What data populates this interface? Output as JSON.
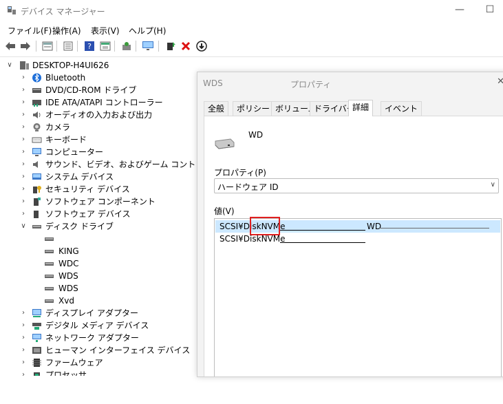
{
  "window": {
    "title": "デバイス マネージャー",
    "minimize_glyph": "—",
    "maximize_glyph": "☐"
  },
  "menu": [
    "ファイル(F)",
    "操作(A)",
    "表示(V)",
    "ヘルプ(H)"
  ],
  "toolbar_icons": [
    "back-icon",
    "forward-icon",
    "properties-view-icon",
    "help-icon",
    "show-hide-icon",
    "scan-hardware-icon",
    "monitor-icon",
    "update-driver-icon",
    "uninstall-icon",
    "download-icon"
  ],
  "tree": {
    "root": "DESKTOP-H4UI626",
    "categories": [
      {
        "label": "Bluetooth",
        "icon": "bluetooth-icon",
        "expanded": false
      },
      {
        "label": "DVD/CD-ROM ドライブ",
        "icon": "dvd-drive-icon",
        "expanded": false
      },
      {
        "label": "IDE ATA/ATAPI コントローラー",
        "icon": "ide-controller-icon",
        "expanded": false
      },
      {
        "label": "オーディオの入力および出力",
        "icon": "audio-icon",
        "expanded": false
      },
      {
        "label": "カメラ",
        "icon": "camera-icon",
        "expanded": false
      },
      {
        "label": "キーボード",
        "icon": "keyboard-icon",
        "expanded": false
      },
      {
        "label": "コンピューター",
        "icon": "computer-icon",
        "expanded": false
      },
      {
        "label": "サウンド、ビデオ、およびゲーム コントローラー",
        "icon": "sound-icon",
        "expanded": false
      },
      {
        "label": "システム デバイス",
        "icon": "system-device-icon",
        "expanded": false
      },
      {
        "label": "セキュリティ デバイス",
        "icon": "security-device-icon",
        "expanded": false
      },
      {
        "label": "ソフトウェア コンポーネント",
        "icon": "software-component-icon",
        "expanded": false
      },
      {
        "label": "ソフトウェア デバイス",
        "icon": "software-device-icon",
        "expanded": false
      },
      {
        "label": "ディスク ドライブ",
        "icon": "disk-drive-icon",
        "expanded": true
      },
      {
        "label": "ディスプレイ アダプター",
        "icon": "display-adapter-icon",
        "expanded": false
      },
      {
        "label": "デジタル メディア デバイス",
        "icon": "digital-media-icon",
        "expanded": false
      },
      {
        "label": "ネットワーク アダプター",
        "icon": "network-adapter-icon",
        "expanded": false
      },
      {
        "label": "ヒューマン インターフェイス デバイス",
        "icon": "hid-icon",
        "expanded": false
      },
      {
        "label": "ファームウェア",
        "icon": "firmware-icon",
        "expanded": false
      },
      {
        "label": "プロセッサ",
        "icon": "processor-icon",
        "expanded": false
      }
    ],
    "disk_children": [
      "",
      "KING",
      "WDC",
      "WDS",
      "WDS",
      "Xvd"
    ]
  },
  "dialog": {
    "title_device": "WDS",
    "title": "プロパティ",
    "close_glyph": "✕",
    "tabs": [
      "全般",
      "ポリシー",
      "ボリューム",
      "ドライバー",
      "詳細",
      "イベント"
    ],
    "active_tab": "詳細",
    "device_name": "WD",
    "property_label": "プロパティ(P)",
    "property_value": "ハードウェア ID",
    "value_label": "値(V)",
    "values": [
      {
        "prefix": "SCSI¥DiskNVMe",
        "suffix": "WD",
        "selected": true
      },
      {
        "prefix": "SCSI¥DiskNVMe",
        "suffix": "",
        "selected": false
      }
    ]
  }
}
